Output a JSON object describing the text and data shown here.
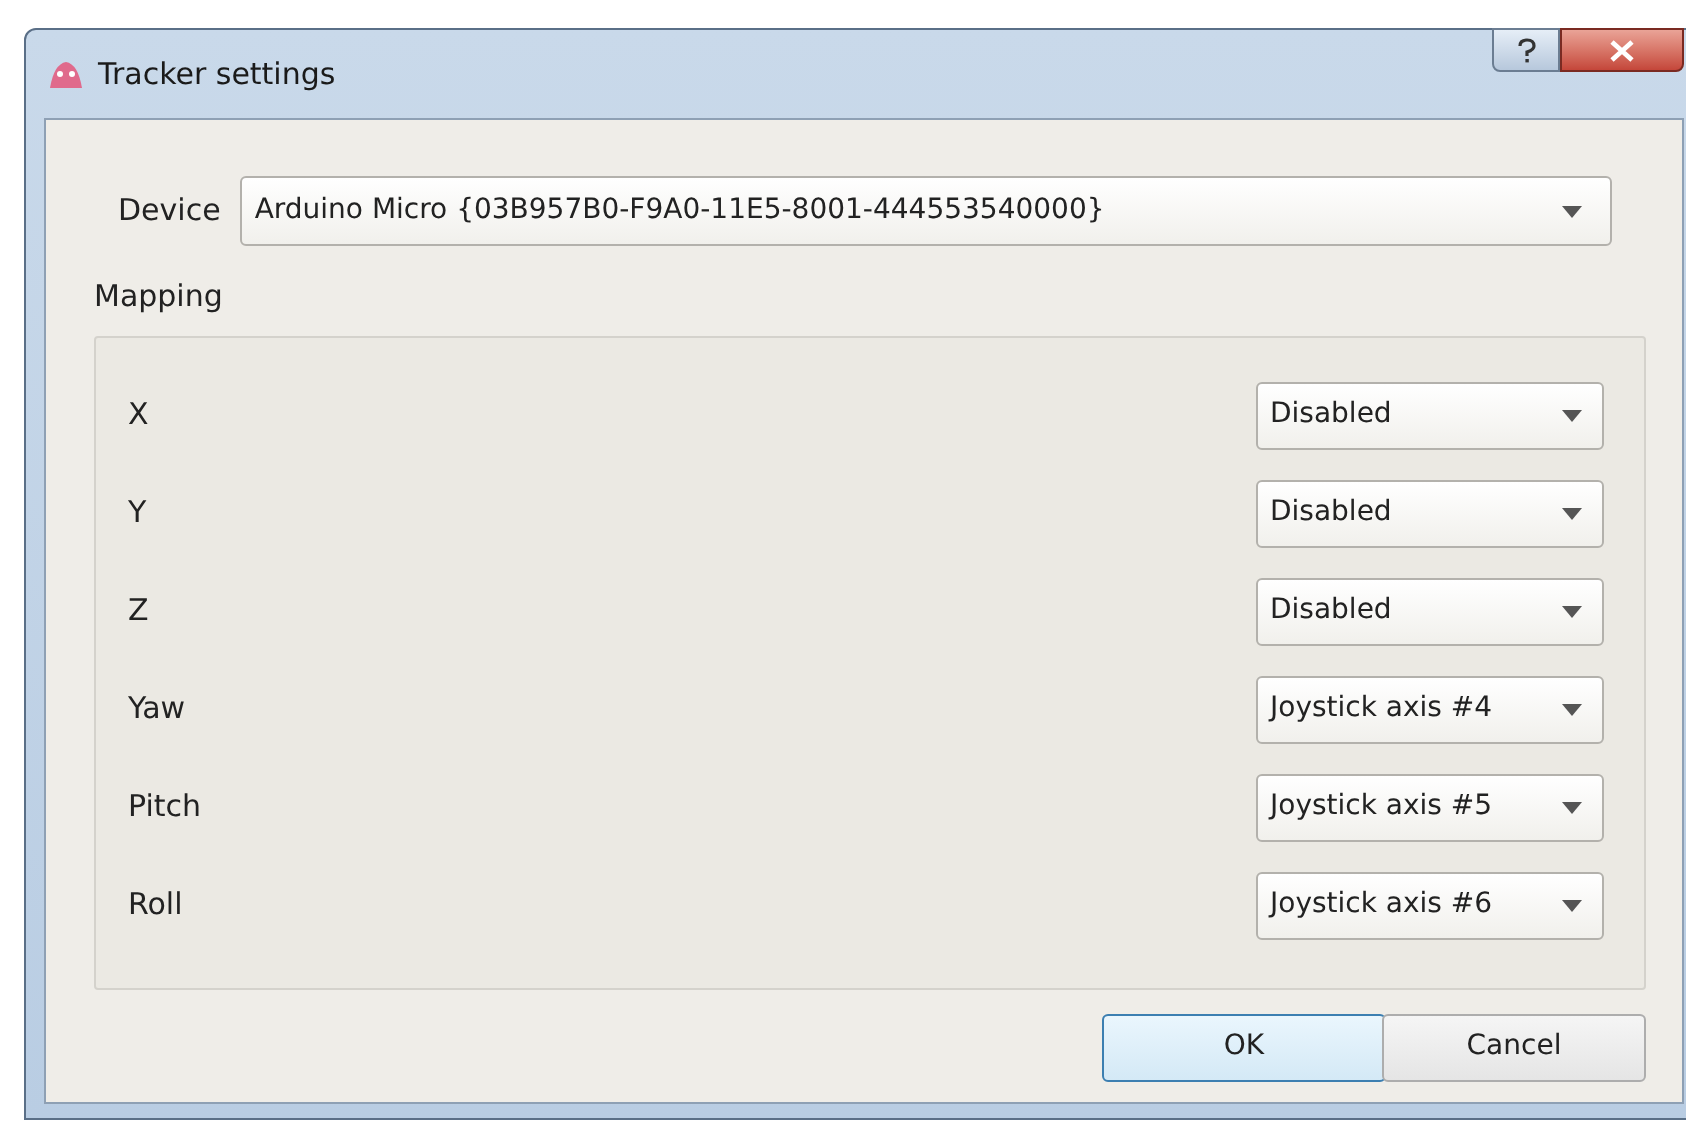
{
  "window": {
    "title": "Tracker settings"
  },
  "device": {
    "label": "Device",
    "value": "Arduino Micro {03B957B0-F9A0-11E5-8001-444553540000}"
  },
  "mapping": {
    "title": "Mapping",
    "rows": [
      {
        "label": "X",
        "value": "Disabled"
      },
      {
        "label": "Y",
        "value": "Disabled"
      },
      {
        "label": "Z",
        "value": "Disabled"
      },
      {
        "label": "Yaw",
        "value": "Joystick axis #4"
      },
      {
        "label": "Pitch",
        "value": "Joystick axis #5"
      },
      {
        "label": "Roll",
        "value": "Joystick axis #6"
      }
    ]
  },
  "buttons": [
    {
      "label": "OK",
      "default": true
    },
    {
      "label": "Cancel",
      "default": false
    }
  ]
}
